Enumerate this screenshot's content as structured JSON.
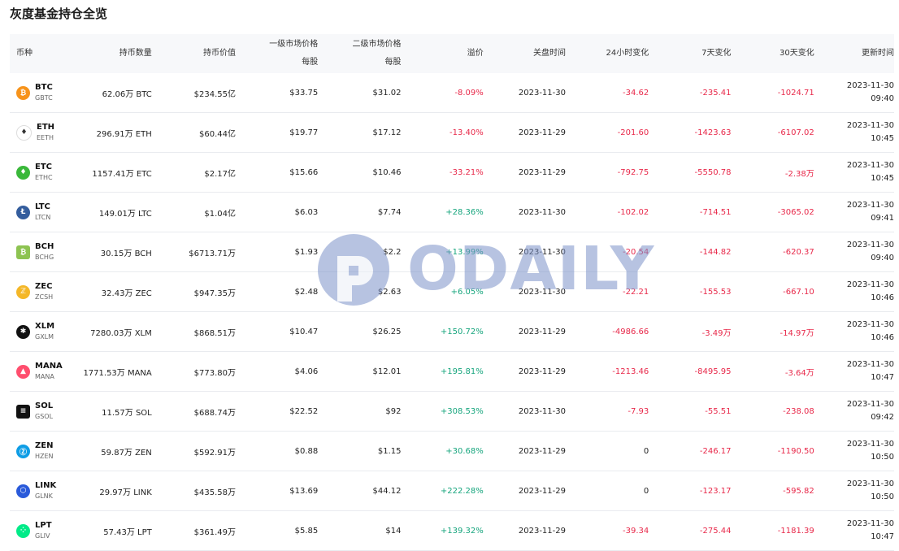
{
  "page": {
    "title": "灰度基金持仓全览"
  },
  "table": {
    "headers": {
      "coin": "币种",
      "holdings": "持币数量",
      "value": "持币价值",
      "primary_line1": "一级市场价格",
      "primary_line2": "每股",
      "secondary_line1": "二级市场价格",
      "secondary_line2": "每股",
      "premium": "溢价",
      "close_time": "关盘时间",
      "change_24h": "24小时变化",
      "change_7d": "7天变化",
      "change_30d": "30天变化",
      "updated": "更新时间"
    },
    "rows": [
      {
        "symbol": "BTC",
        "fund": "GBTC",
        "icon": "bitcoin-icon",
        "icon_color": "#f7931a",
        "icon_glyph": "₿",
        "holdings": "62.06万 BTC",
        "value": "$234.55亿",
        "primary": "$33.75",
        "secondary": "$31.02",
        "premium": "-8.09%",
        "premium_sign": "neg",
        "close": "2023-11-30",
        "c24": "-34.62",
        "c24_sign": "neg",
        "c7": "-235.41",
        "c7_sign": "neg",
        "c30": "-1024.71",
        "c30_sign": "neg",
        "upd_date": "2023-11-30",
        "upd_time": "09:40"
      },
      {
        "symbol": "ETH",
        "fund": "EETH",
        "icon": "ethereum-icon",
        "icon_color": "#ffffff",
        "icon_glyph": "♦",
        "holdings": "296.91万 ETH",
        "value": "$60.44亿",
        "primary": "$19.77",
        "secondary": "$17.12",
        "premium": "-13.40%",
        "premium_sign": "neg",
        "close": "2023-11-29",
        "c24": "-201.60",
        "c24_sign": "neg",
        "c7": "-1423.63",
        "c7_sign": "neg",
        "c30": "-6107.02",
        "c30_sign": "neg",
        "upd_date": "2023-11-30",
        "upd_time": "10:45"
      },
      {
        "symbol": "ETC",
        "fund": "ETHC",
        "icon": "ethereum-classic-icon",
        "icon_color": "#3ab83a",
        "icon_glyph": "♦",
        "holdings": "1157.41万 ETC",
        "value": "$2.17亿",
        "primary": "$15.66",
        "secondary": "$10.46",
        "premium": "-33.21%",
        "premium_sign": "neg",
        "close": "2023-11-29",
        "c24": "-792.75",
        "c24_sign": "neg",
        "c7": "-5550.78",
        "c7_sign": "neg",
        "c30": "-2.38万",
        "c30_sign": "neg",
        "upd_date": "2023-11-30",
        "upd_time": "10:45"
      },
      {
        "symbol": "LTC",
        "fund": "LTCN",
        "icon": "litecoin-icon",
        "icon_color": "#345d9d",
        "icon_glyph": "Ł",
        "holdings": "149.01万 LTC",
        "value": "$1.04亿",
        "primary": "$6.03",
        "secondary": "$7.74",
        "premium": "+28.36%",
        "premium_sign": "pos",
        "close": "2023-11-30",
        "c24": "-102.02",
        "c24_sign": "neg",
        "c7": "-714.51",
        "c7_sign": "neg",
        "c30": "-3065.02",
        "c30_sign": "neg",
        "upd_date": "2023-11-30",
        "upd_time": "09:41"
      },
      {
        "symbol": "BCH",
        "fund": "BCHG",
        "icon": "bitcoin-cash-icon",
        "icon_color": "#8dc351",
        "icon_glyph": "₿",
        "holdings": "30.15万 BCH",
        "value": "$6713.71万",
        "primary": "$1.93",
        "secondary": "$2.2",
        "premium": "+13.99%",
        "premium_sign": "pos",
        "close": "2023-11-30",
        "c24": "-20.54",
        "c24_sign": "neg",
        "c7": "-144.82",
        "c7_sign": "neg",
        "c30": "-620.37",
        "c30_sign": "neg",
        "upd_date": "2023-11-30",
        "upd_time": "09:40"
      },
      {
        "symbol": "ZEC",
        "fund": "ZCSH",
        "icon": "zcash-icon",
        "icon_color": "#f4b728",
        "icon_glyph": "ℤ",
        "holdings": "32.43万 ZEC",
        "value": "$947.35万",
        "primary": "$2.48",
        "secondary": "$2.63",
        "premium": "+6.05%",
        "premium_sign": "pos",
        "close": "2023-11-30",
        "c24": "-22.21",
        "c24_sign": "neg",
        "c7": "-155.53",
        "c7_sign": "neg",
        "c30": "-667.10",
        "c30_sign": "neg",
        "upd_date": "2023-11-30",
        "upd_time": "10:46"
      },
      {
        "symbol": "XLM",
        "fund": "GXLM",
        "icon": "stellar-icon",
        "icon_color": "#111111",
        "icon_glyph": "✱",
        "holdings": "7280.03万 XLM",
        "value": "$868.51万",
        "primary": "$10.47",
        "secondary": "$26.25",
        "premium": "+150.72%",
        "premium_sign": "pos",
        "close": "2023-11-29",
        "c24": "-4986.66",
        "c24_sign": "neg",
        "c7": "-3.49万",
        "c7_sign": "neg",
        "c30": "-14.97万",
        "c30_sign": "neg",
        "upd_date": "2023-11-30",
        "upd_time": "10:46"
      },
      {
        "symbol": "MANA",
        "fund": "MANA",
        "icon": "decentraland-icon",
        "icon_color": "#ff4e6e",
        "icon_glyph": "▲",
        "holdings": "1771.53万 MANA",
        "value": "$773.80万",
        "primary": "$4.06",
        "secondary": "$12.01",
        "premium": "+195.81%",
        "premium_sign": "pos",
        "close": "2023-11-29",
        "c24": "-1213.46",
        "c24_sign": "neg",
        "c7": "-8495.95",
        "c7_sign": "neg",
        "c30": "-3.64万",
        "c30_sign": "neg",
        "upd_date": "2023-11-30",
        "upd_time": "10:47"
      },
      {
        "symbol": "SOL",
        "fund": "GSOL",
        "icon": "solana-icon",
        "icon_color": "#111111",
        "icon_glyph": "≡",
        "holdings": "11.57万 SOL",
        "value": "$688.74万",
        "primary": "$22.52",
        "secondary": "$92",
        "premium": "+308.53%",
        "premium_sign": "pos",
        "close": "2023-11-30",
        "c24": "-7.93",
        "c24_sign": "neg",
        "c7": "-55.51",
        "c7_sign": "neg",
        "c30": "-238.08",
        "c30_sign": "neg",
        "upd_date": "2023-11-30",
        "upd_time": "09:42"
      },
      {
        "symbol": "ZEN",
        "fund": "HZEN",
        "icon": "horizen-icon",
        "icon_color": "#0e9de5",
        "icon_glyph": "Ⓩ",
        "holdings": "59.87万 ZEN",
        "value": "$592.91万",
        "primary": "$0.88",
        "secondary": "$1.15",
        "premium": "+30.68%",
        "premium_sign": "pos",
        "close": "2023-11-29",
        "c24": "0",
        "c24_sign": "zero",
        "c7": "-246.17",
        "c7_sign": "neg",
        "c30": "-1190.50",
        "c30_sign": "neg",
        "upd_date": "2023-11-30",
        "upd_time": "10:50"
      },
      {
        "symbol": "LINK",
        "fund": "GLNK",
        "icon": "chainlink-icon",
        "icon_color": "#2a5ada",
        "icon_glyph": "⬡",
        "holdings": "29.97万 LINK",
        "value": "$435.58万",
        "primary": "$13.69",
        "secondary": "$44.12",
        "premium": "+222.28%",
        "premium_sign": "pos",
        "close": "2023-11-29",
        "c24": "0",
        "c24_sign": "zero",
        "c7": "-123.17",
        "c7_sign": "neg",
        "c30": "-595.82",
        "c30_sign": "neg",
        "upd_date": "2023-11-30",
        "upd_time": "10:50"
      },
      {
        "symbol": "LPT",
        "fund": "GLIV",
        "icon": "livepeer-icon",
        "icon_color": "#00eb88",
        "icon_glyph": "⁘",
        "holdings": "57.43万 LPT",
        "value": "$361.49万",
        "primary": "$5.85",
        "secondary": "$14",
        "premium": "+139.32%",
        "premium_sign": "pos",
        "close": "2023-11-29",
        "c24": "-39.34",
        "c24_sign": "neg",
        "c7": "-275.44",
        "c7_sign": "neg",
        "c30": "-1181.39",
        "c30_sign": "neg",
        "upd_date": "2023-11-30",
        "upd_time": "10:47"
      }
    ]
  },
  "watermark": {
    "text": "ODAILY"
  }
}
